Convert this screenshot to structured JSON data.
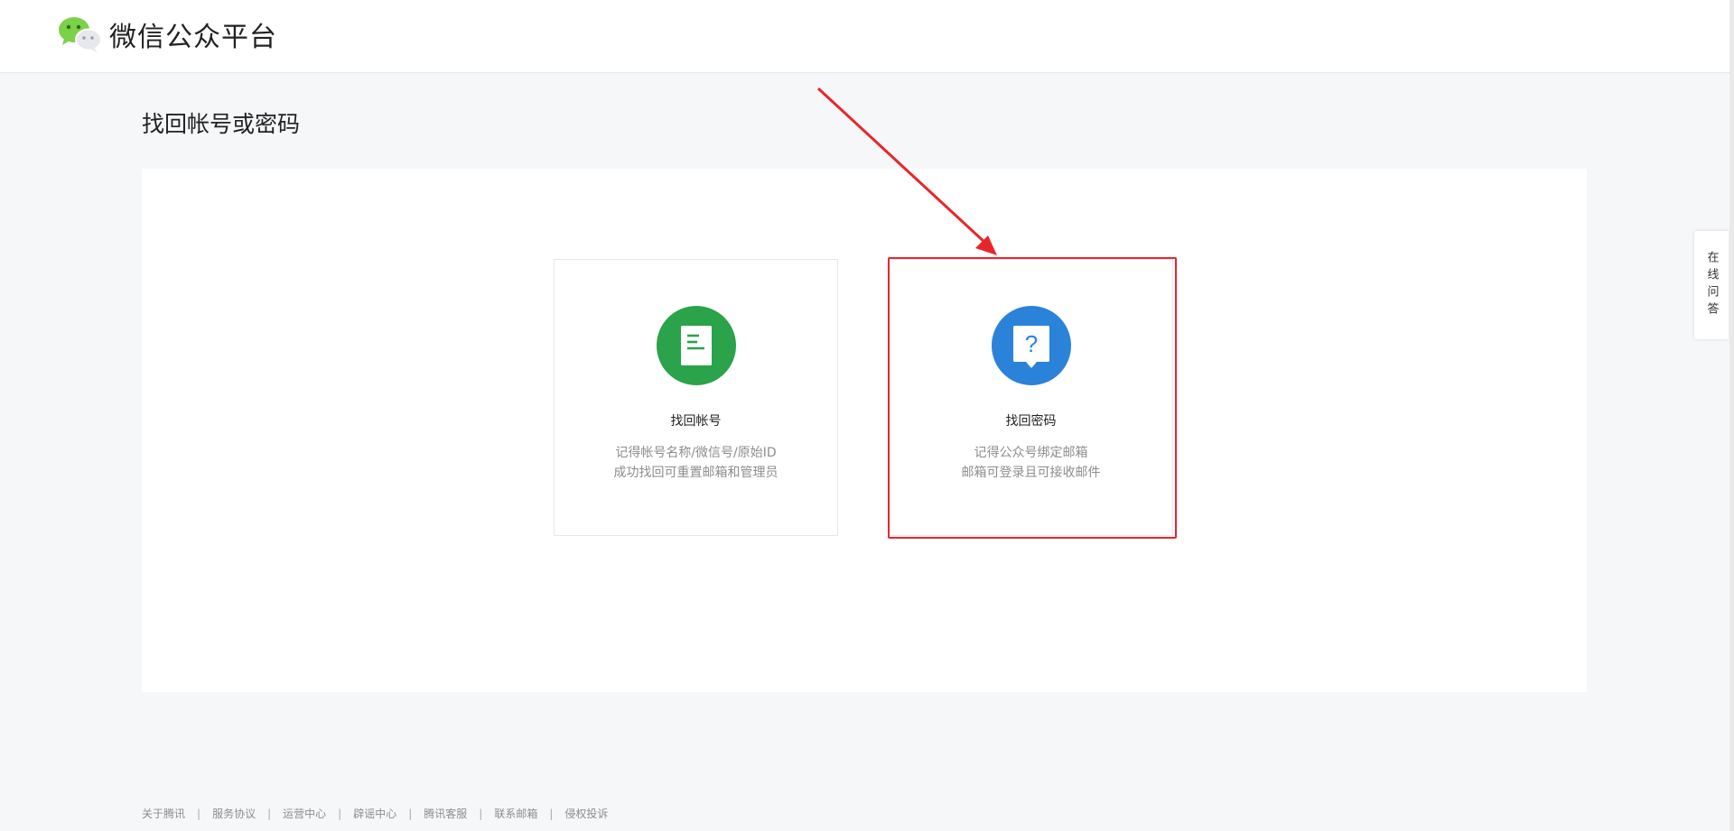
{
  "header": {
    "logo_text": "微信公众平台",
    "logo_icon": "wechat-logo-icon"
  },
  "page": {
    "title": "找回帐号或密码"
  },
  "cards": [
    {
      "id": "find-account",
      "title": "找回帐号",
      "desc_line1": "记得帐号名称/微信号/原始ID",
      "desc_line2": "成功找回可重置邮箱和管理员",
      "icon": "document-icon",
      "icon_color": "#2aa34a"
    },
    {
      "id": "find-password",
      "title": "找回密码",
      "desc_line1": "记得公众号绑定邮箱",
      "desc_line2": "邮箱可登录且可接收邮件",
      "icon": "question-bubble-icon",
      "icon_color": "#2b82d9"
    }
  ],
  "side_tab": {
    "label": "在线问答"
  },
  "footer": {
    "links": [
      "关于腾讯",
      "服务协议",
      "运营中心",
      "辟谣中心",
      "腾讯客服",
      "联系邮箱",
      "侵权投诉"
    ],
    "separator": "|"
  },
  "annotation": {
    "color": "#e8262a"
  }
}
